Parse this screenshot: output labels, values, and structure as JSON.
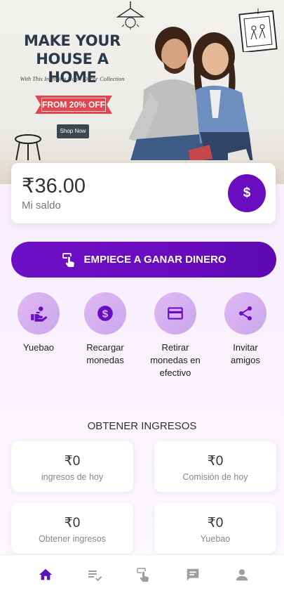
{
  "banner": {
    "title_line1": "MAKE YOUR",
    "title_line2": "HOUSE A HOME",
    "subtitle": "With This Inspiring Home Decor Collection",
    "offer": "FROM 20% OFF",
    "shop_button": "Shop Now"
  },
  "balance": {
    "amount": "₹36.00",
    "label": "Mi saldo",
    "button_symbol": "$"
  },
  "earn_button": {
    "label": "EMPIECE A GANAR DINERO"
  },
  "actions": [
    {
      "label": "Yuebao",
      "icon": "hand-coin-icon"
    },
    {
      "label": "Recargar monedas",
      "icon": "dollar-circle-icon"
    },
    {
      "label": "Retirar monedas en efectivo",
      "icon": "credit-card-icon"
    },
    {
      "label": "Invitar amigos",
      "icon": "share-icon"
    }
  ],
  "income": {
    "title": "OBTENER INGRESOS",
    "stats": [
      {
        "value": "₹0",
        "label": "ingresos de hoy"
      },
      {
        "value": "₹0",
        "label": "Comisión de hoy"
      },
      {
        "value": "₹0",
        "label": "Obtener ingresos"
      },
      {
        "value": "₹0",
        "label": "Yuebao"
      }
    ]
  },
  "nav": {
    "items": [
      {
        "icon": "home-icon",
        "active": true
      },
      {
        "icon": "task-list-icon",
        "active": false
      },
      {
        "icon": "tap-hand-icon",
        "active": false
      },
      {
        "icon": "message-icon",
        "active": false
      },
      {
        "icon": "profile-icon",
        "active": false
      }
    ]
  },
  "colors": {
    "primary": "#6a0dc1",
    "nav_active": "#5a16b8",
    "nav_inactive": "#9e9e9e",
    "offer_red": "#e2474f",
    "banner_title": "#2b3a4a"
  }
}
